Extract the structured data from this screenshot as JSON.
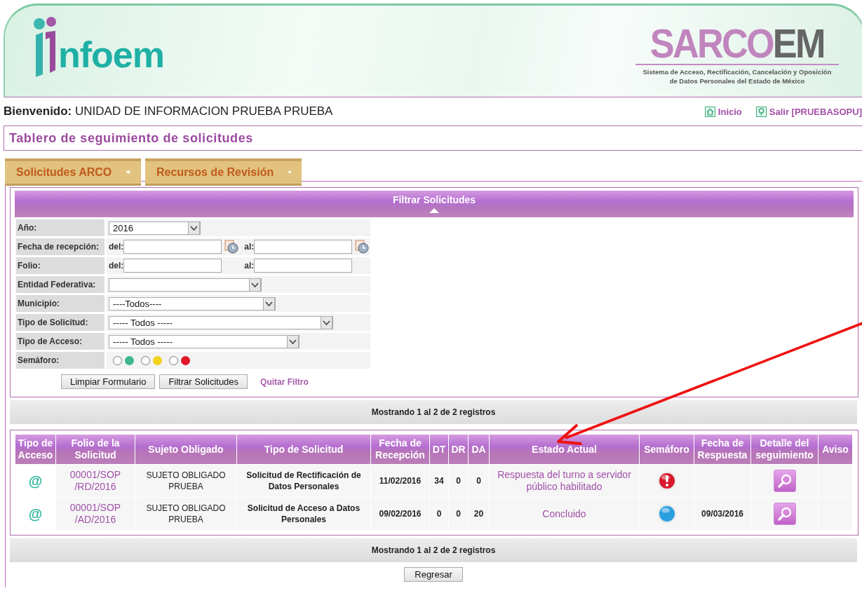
{
  "header": {
    "logo_left": "nfoem",
    "logo_main": "SARCO",
    "logo_accent": "EM",
    "subtitle_lines": [
      "Sistema de Acceso, Rectificación, Cancelación y Oposición",
      "de Datos Personales del Estado de México"
    ]
  },
  "welcome": {
    "label": "Bienvenido:",
    "name": "UNIDAD DE INFORMACION PRUEBA PRUEBA"
  },
  "top_links": [
    {
      "label": "Inicio",
      "kind": "home"
    },
    {
      "label": "Salir [PRUEBASOPU]",
      "kind": "exit"
    }
  ],
  "page_title": "Tablero de seguimiento de solicitudes",
  "menu": [
    "Solicitudes ARCO",
    "Recursos de Revisión"
  ],
  "filter": {
    "title": "Filtrar Solicitudes",
    "rows": [
      {
        "kind": "select",
        "label": "Año:",
        "value": "2016"
      },
      {
        "kind": "date_range",
        "label": "Fecha de recepción:",
        "from": "del:",
        "to": "al:"
      },
      {
        "kind": "range",
        "label": "Folio:",
        "from": "del:",
        "to": "al:"
      },
      {
        "kind": "select",
        "label": "Entidad Federativa:"
      },
      {
        "kind": "select",
        "label": "Municipio:",
        "value": "----Todos----"
      },
      {
        "kind": "select",
        "label": "Tipo de Solicitud:",
        "value": "----- Todos -----"
      },
      {
        "kind": "select",
        "label": "Tipo de Acceso:",
        "value": "----- Todos -----"
      },
      {
        "kind": "lights",
        "label": "Semáforo:",
        "options": [
          {
            "color": "#3db88a",
            "selected": false
          },
          {
            "color": "#f2d21b",
            "selected": false
          },
          {
            "color": "#e0162b",
            "selected": false
          }
        ]
      }
    ],
    "buttons": [
      "Limpiar Formulario",
      "Filtrar Solicitudes"
    ],
    "link": "Quitar Filtro"
  },
  "summary_top": "Mostrando 1 al 2 de 2 registros",
  "table": {
    "columns": [
      "Tipo de Acceso",
      "Folio de la Solicitud",
      "Sujeto Obligado",
      "Tipo de Solicitud",
      "Fecha de Recepción",
      "DT",
      "DR",
      "DA",
      "Estado Actual",
      "Semáforo",
      "Fecha de Respuesta",
      "Detalle del seguimiento",
      "Aviso"
    ],
    "rows": [
      {
        "access": "@",
        "folio": "00001/SOP /RD/2016",
        "subject": "SUJETO OBLIGADO PRUEBA",
        "type": "Solicitud de Rectificación de Datos Personales",
        "received": "11/02/2016",
        "dt": "34",
        "dr": "0",
        "da": "0",
        "status": "Respuesta del turno a servidor público habilitado",
        "light": {
          "kind": "alert",
          "color": "#d9182b"
        }
      },
      {
        "access": "@",
        "folio": "00001/SOP /AD/2016",
        "subject": "SUJETO OBLIGADO PRUEBA",
        "type": "Solicitud de Acceso a Datos Personales",
        "received": "09/02/2016",
        "dt": "0",
        "dr": "0",
        "da": "20",
        "status": "Concluido",
        "light": {
          "kind": "plain",
          "color": "#2a9fe0"
        },
        "answered": "09/03/2016"
      }
    ]
  },
  "summary_bottom": "Mostrando 1 al 2 de 2 registros",
  "back_button": "Regresar"
}
